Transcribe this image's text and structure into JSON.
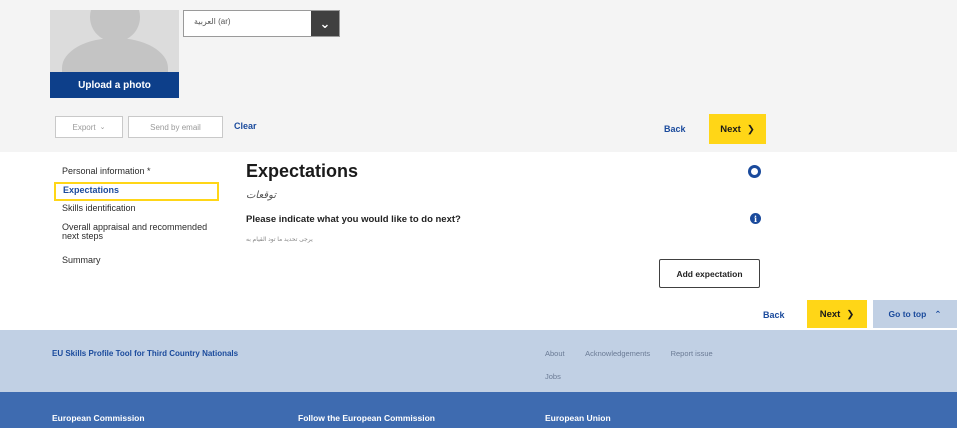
{
  "profile": {
    "upload_label": "Upload a photo",
    "language_select_value": "(ar) العربية"
  },
  "toolbar": {
    "export_label": "Export",
    "send_by_email_label": "Send by email",
    "clear_label": "Clear",
    "back_label": "Back",
    "next_label": "Next"
  },
  "steps": [
    {
      "label": "Personal information *",
      "active": false
    },
    {
      "label": "Expectations",
      "active": true
    },
    {
      "label": "Skills identification",
      "active": false
    },
    {
      "label": "Overall appraisal and recommended next steps",
      "active": false
    },
    {
      "label": "Summary",
      "active": false
    }
  ],
  "main": {
    "title": "Expectations",
    "title_arabic": "توقعات",
    "question": "Please indicate what you would like to do next?",
    "question_arabic_sub": "يرجى تحديد ما تود القيام به",
    "add_expectation_label": "Add expectation",
    "icons": {
      "section_ring": "ring-icon",
      "info": "info-icon"
    }
  },
  "bottom_nav": {
    "back_label": "Back",
    "next_label": "Next",
    "go_to_top_label": "Go to top"
  },
  "footer": {
    "tool_title": "EU Skills Profile Tool for Third Country Nationals",
    "links": [
      "About",
      "Acknowledgements",
      "Report issue",
      "Jobs"
    ],
    "columns": [
      "European Commission",
      "Follow the European Commission",
      "European Union"
    ]
  },
  "colors": {
    "primary_blue": "#0d3f8a",
    "link_blue": "#1a4a9c",
    "accent_yellow": "#ffd617",
    "footer_light": "#c1d0e4",
    "footer_dark": "#3e6bb0"
  }
}
